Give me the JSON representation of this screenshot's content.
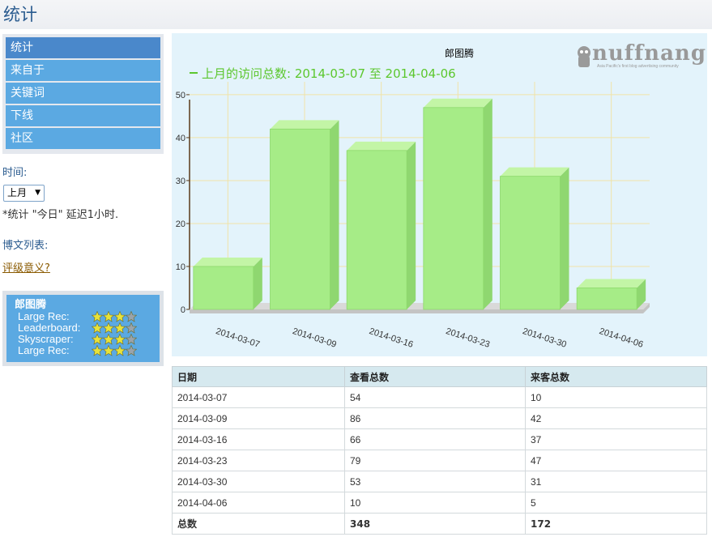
{
  "page": {
    "title": "统计"
  },
  "sidebar": {
    "items": [
      {
        "label": "统计",
        "active": true
      },
      {
        "label": "来自于",
        "active": false
      },
      {
        "label": "关键词",
        "active": false
      },
      {
        "label": "下线",
        "active": false
      },
      {
        "label": "社区",
        "active": false
      }
    ],
    "time_label": "时间:",
    "period_value": "上月",
    "delay_note": "*统计 \"今日\" 延迟1小时.",
    "posts_label": "博文列表:",
    "rating_link": "评级意义?"
  },
  "rating": {
    "name": "郎图腾",
    "rows": [
      {
        "label": "Large Rec:",
        "stars": 3,
        "max": 4
      },
      {
        "label": "Leaderboard:",
        "stars": 3,
        "max": 4
      },
      {
        "label": "Skyscraper:",
        "stars": 3,
        "max": 4
      },
      {
        "label": "Large Rec:",
        "stars": 3,
        "max": 4
      }
    ],
    "colors": {
      "star_on": "#e8e23a",
      "star_off": "#9aa3ab"
    }
  },
  "logo": {
    "text": "nuffnang",
    "tagline": "Asia Pacific's first blog advertising community"
  },
  "chart_data": {
    "type": "bar",
    "title": "郎图腾",
    "legend": "上月的访问总数: 2014-03-07 至 2014-04-06",
    "legend_position": "top-left",
    "categories": [
      "2014-03-07",
      "2014-03-09",
      "2014-03-16",
      "2014-03-23",
      "2014-03-30",
      "2014-04-06"
    ],
    "series": [
      {
        "name": "上月的访问总数: 2014-03-07 至 2014-04-06",
        "values": [
          10,
          42,
          37,
          47,
          31,
          5
        ]
      }
    ],
    "yticks": [
      0,
      10,
      20,
      30,
      40,
      50
    ],
    "ylim": [
      0,
      53
    ],
    "grid": true,
    "colors": {
      "bar": "#a6ec87",
      "bar_top": "#c3f5a6",
      "bar_side": "#8fd770",
      "grid": "#f0e3a8",
      "legend": "#5cc72e"
    }
  },
  "table": {
    "headers": [
      "日期",
      "查看总数",
      "来客总数"
    ],
    "rows": [
      [
        "2014-03-07",
        "54",
        "10"
      ],
      [
        "2014-03-09",
        "86",
        "42"
      ],
      [
        "2014-03-16",
        "66",
        "37"
      ],
      [
        "2014-03-23",
        "79",
        "47"
      ],
      [
        "2014-03-30",
        "53",
        "31"
      ],
      [
        "2014-04-06",
        "10",
        "5"
      ]
    ],
    "total": [
      "总数",
      "348",
      "172"
    ]
  }
}
